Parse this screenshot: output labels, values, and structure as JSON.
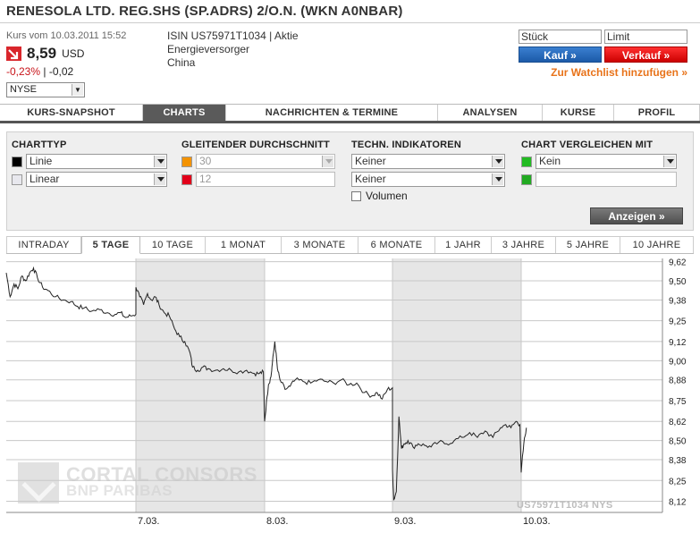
{
  "header": {
    "title": "RENESOLA LTD. REG.SHS (SP.ADRS) 2/O.N. (WKN A0NBAR)"
  },
  "quote": {
    "date_label": "Kurs vom 10.03.2011 15:52",
    "price": "8,59",
    "currency": "USD",
    "change_pct": "-0,23%",
    "separator": "|",
    "change_abs": "-0,02",
    "exchange": "NYSE",
    "trend_icon": "down-arrow-icon",
    "trend_color": "#d9262c"
  },
  "info": {
    "isin_line": "ISIN US75971T1034 | Aktie",
    "sector": "Energieversorger",
    "country": "China"
  },
  "order": {
    "qty_placeholder": "Stück",
    "limit_placeholder": "Limit",
    "buy_label": "Kauf »",
    "sell_label": "Verkauf »",
    "watchlist_label": "Zur Watchlist hinzufügen »",
    "buy_color": "#1c5aa8",
    "sell_color": "#cc0000",
    "watchlist_color": "#e8731a"
  },
  "main_tabs": [
    {
      "label": "KURS-SNAPSHOT",
      "active": false
    },
    {
      "label": "CHARTS",
      "active": true
    },
    {
      "label": "NACHRICHTEN & TERMINE",
      "active": false
    },
    {
      "label": "ANALYSEN",
      "active": false
    },
    {
      "label": "KURSE",
      "active": false
    },
    {
      "label": "PROFIL",
      "active": false
    }
  ],
  "settings": {
    "charttyp": {
      "heading": "CHARTTYP",
      "type": "Linie",
      "scale": "Linear",
      "type_color": "#000000",
      "scale_color": "#e8e8ee"
    },
    "gd": {
      "heading": "GLEITENDER DURCHSCHNITT",
      "value1": "30",
      "value2": "12",
      "color1": "#f39200",
      "color2": "#e2001a"
    },
    "indikatoren": {
      "heading": "TECHN. INDIKATOREN",
      "value1": "Keiner",
      "value2": "Keiner",
      "volume_label": "Volumen",
      "volume_checked": false
    },
    "vergleich": {
      "heading": "CHART VERGLEICHEN MIT",
      "value1": "Kein",
      "value2": "",
      "color1": "#22bb22",
      "color2": "#22aa22"
    },
    "submit_label": "Anzeigen »"
  },
  "range_tabs": [
    {
      "label": "INTRADAY",
      "active": false
    },
    {
      "label": "5 TAGE",
      "active": true
    },
    {
      "label": "10 TAGE",
      "active": false
    },
    {
      "label": "1 MONAT",
      "active": false
    },
    {
      "label": "3 MONATE",
      "active": false
    },
    {
      "label": "6 MONATE",
      "active": false
    },
    {
      "label": "1 JAHR",
      "active": false
    },
    {
      "label": "3 JAHRE",
      "active": false
    },
    {
      "label": "5 JAHRE",
      "active": false
    },
    {
      "label": "10 JAHRE",
      "active": false
    }
  ],
  "watermark": {
    "line1": "CORTAL CONSORS",
    "line2": "BNP PARIBAS"
  },
  "chart_id": "US75971T1034 NYS",
  "chart_data": {
    "type": "line",
    "title": "",
    "xlabel": "",
    "ylabel": "",
    "ylim": [
      8.05,
      9.64
    ],
    "y_ticks": [
      "9,62",
      "9,50",
      "9,38",
      "9,25",
      "9,12",
      "9,00",
      "8,88",
      "8,75",
      "8,62",
      "8,50",
      "8,38",
      "8,25",
      "8,12"
    ],
    "y_tick_values": [
      9.62,
      9.5,
      9.38,
      9.25,
      9.12,
      9.0,
      8.88,
      8.75,
      8.62,
      8.5,
      8.38,
      8.25,
      8.12
    ],
    "x_labels": [
      "7.03.",
      "8.03.",
      "9.03.",
      "10.03."
    ],
    "grid": true,
    "line_color": "#222222",
    "series": [
      {
        "values": [
          [
            0.0,
            9.55
          ],
          [
            0.03,
            9.4
          ],
          [
            0.06,
            9.48
          ],
          [
            0.09,
            9.45
          ],
          [
            0.12,
            9.53
          ],
          [
            0.15,
            9.5
          ],
          [
            0.18,
            9.55
          ],
          [
            0.21,
            9.58
          ],
          [
            0.24,
            9.52
          ],
          [
            0.28,
            9.46
          ],
          [
            0.32,
            9.44
          ],
          [
            0.38,
            9.4
          ],
          [
            0.44,
            9.38
          ],
          [
            0.5,
            9.37
          ],
          [
            0.55,
            9.34
          ],
          [
            0.6,
            9.33
          ],
          [
            0.66,
            9.31
          ],
          [
            0.72,
            9.32
          ],
          [
            0.78,
            9.3
          ],
          [
            0.84,
            9.29
          ],
          [
            0.88,
            9.3
          ],
          [
            0.92,
            9.27
          ],
          [
            0.96,
            9.28
          ],
          [
            1.0,
            9.29
          ],
          [
            1.0,
            9.46
          ],
          [
            1.03,
            9.4
          ],
          [
            1.06,
            9.35
          ],
          [
            1.09,
            9.42
          ],
          [
            1.12,
            9.38
          ],
          [
            1.15,
            9.4
          ],
          [
            1.18,
            9.35
          ],
          [
            1.22,
            9.3
          ],
          [
            1.26,
            9.28
          ],
          [
            1.3,
            9.2
          ],
          [
            1.34,
            9.15
          ],
          [
            1.38,
            9.12
          ],
          [
            1.42,
            9.05
          ],
          [
            1.44,
            8.96
          ],
          [
            1.48,
            8.94
          ],
          [
            1.52,
            8.96
          ],
          [
            1.56,
            8.95
          ],
          [
            1.62,
            8.94
          ],
          [
            1.68,
            8.95
          ],
          [
            1.74,
            8.94
          ],
          [
            1.8,
            8.93
          ],
          [
            1.86,
            8.94
          ],
          [
            1.92,
            8.92
          ],
          [
            1.96,
            8.92
          ],
          [
            1.99,
            8.93
          ],
          [
            2.0,
            8.62
          ],
          [
            2.02,
            8.78
          ],
          [
            2.03,
            8.85
          ],
          [
            2.05,
            8.9
          ],
          [
            2.06,
            8.98
          ],
          [
            2.08,
            9.12
          ],
          [
            2.1,
            8.95
          ],
          [
            2.12,
            8.88
          ],
          [
            2.16,
            8.82
          ],
          [
            2.2,
            8.84
          ],
          [
            2.24,
            8.88
          ],
          [
            2.3,
            8.87
          ],
          [
            2.36,
            8.86
          ],
          [
            2.42,
            8.88
          ],
          [
            2.48,
            8.87
          ],
          [
            2.54,
            8.86
          ],
          [
            2.6,
            8.88
          ],
          [
            2.66,
            8.85
          ],
          [
            2.72,
            8.86
          ],
          [
            2.78,
            8.8
          ],
          [
            2.84,
            8.78
          ],
          [
            2.88,
            8.8
          ],
          [
            2.92,
            8.76
          ],
          [
            2.96,
            8.82
          ],
          [
            3.0,
            8.83
          ],
          [
            3.0,
            8.32
          ],
          [
            3.01,
            8.13
          ],
          [
            3.03,
            8.18
          ],
          [
            3.05,
            8.65
          ],
          [
            3.07,
            8.45
          ],
          [
            3.09,
            8.48
          ],
          [
            3.12,
            8.5
          ],
          [
            3.16,
            8.46
          ],
          [
            3.2,
            8.48
          ],
          [
            3.25,
            8.47
          ],
          [
            3.3,
            8.46
          ],
          [
            3.36,
            8.49
          ],
          [
            3.42,
            8.48
          ],
          [
            3.48,
            8.5
          ],
          [
            3.54,
            8.52
          ],
          [
            3.6,
            8.55
          ],
          [
            3.66,
            8.52
          ],
          [
            3.72,
            8.56
          ],
          [
            3.78,
            8.52
          ],
          [
            3.84,
            8.58
          ],
          [
            3.88,
            8.6
          ],
          [
            3.92,
            8.58
          ],
          [
            3.96,
            8.62
          ],
          [
            3.99,
            8.6
          ],
          [
            4.0,
            8.3
          ],
          [
            4.02,
            8.48
          ],
          [
            4.04,
            8.58
          ]
        ]
      }
    ]
  }
}
